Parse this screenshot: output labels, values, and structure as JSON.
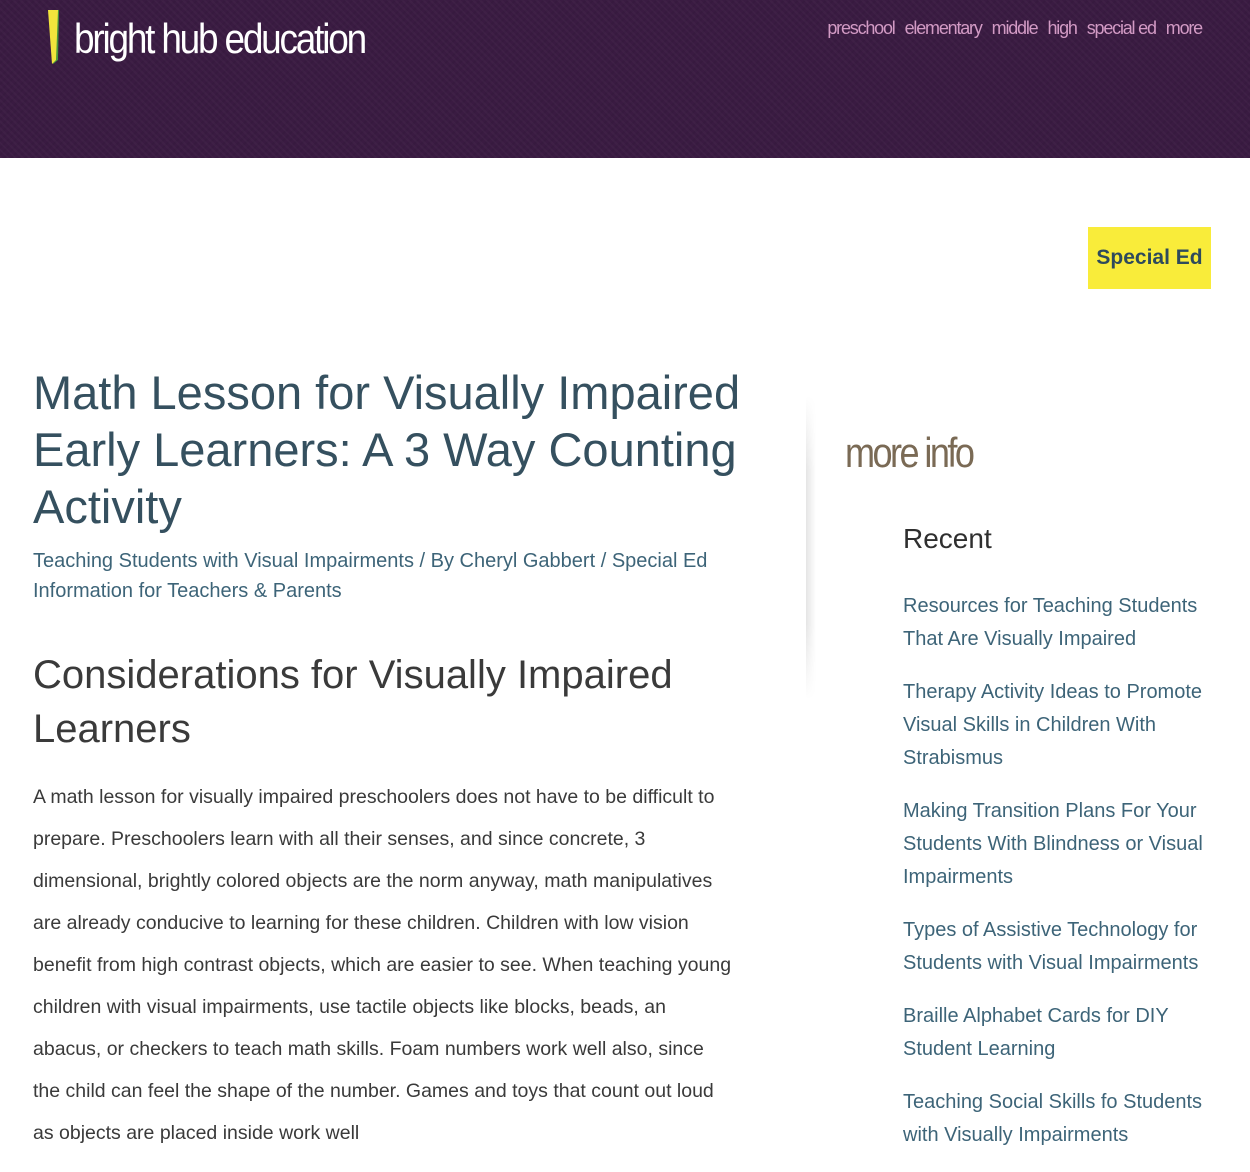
{
  "header": {
    "logo_text": "bright hub education",
    "brand_colors": {
      "background": "#3a1b42",
      "logo_yellow": "#f2e43c",
      "logo_green": "#4a9a3c",
      "nav": "#d29ac4"
    },
    "nav": [
      {
        "label": "preschool"
      },
      {
        "label": "elementary"
      },
      {
        "label": "middle"
      },
      {
        "label": "high"
      },
      {
        "label": "special ed"
      },
      {
        "label": "more"
      }
    ]
  },
  "category_badge": {
    "label": "Special Ed",
    "color": "#f9ec3a"
  },
  "article": {
    "title": "Math Lesson for Visually Impaired Early Learners: A 3 Way Counting Activity",
    "meta": {
      "category": "Teaching Students with Visual Impairments",
      "separator_by": " / By ",
      "author": "Cheryl Gabbert",
      "separator": " / ",
      "section": "Special Ed Information for Teachers & Parents"
    },
    "section_heading": "Considerations for Visually Impaired Learners",
    "body": "A math lesson for visually impaired preschoolers does not have to be difficult to prepare. Preschoolers learn with all their senses, and since concrete, 3 dimensional, brightly colored objects are the norm anyway, math manipulatives are already conducive to learning for these children. Children with low vision benefit from high contrast objects, which are easier to see. When teaching young children with visual impairments, use tactile objects like blocks, beads, an abacus, or checkers to teach math skills. Foam numbers work well also, since the child can feel the shape of the number. Games and toys that count out loud as objects are placed inside work well"
  },
  "sidebar": {
    "heading": "more info",
    "recent_heading": "Recent",
    "recent": [
      {
        "label": "Resources for Teaching Students That Are Visually Impaired"
      },
      {
        "label": "Therapy Activity Ideas to Promote Visual Skills in Children With Strabismus"
      },
      {
        "label": "Making Transition Plans For Your Students With Blindness or Visual Impairments"
      },
      {
        "label": "Types of Assistive Technology for Students with Visual Impairments"
      },
      {
        "label": "Braille Alphabet Cards for DIY Student Learning"
      },
      {
        "label": "Teaching Social Skills fo Students with Visually Impairments"
      }
    ]
  }
}
